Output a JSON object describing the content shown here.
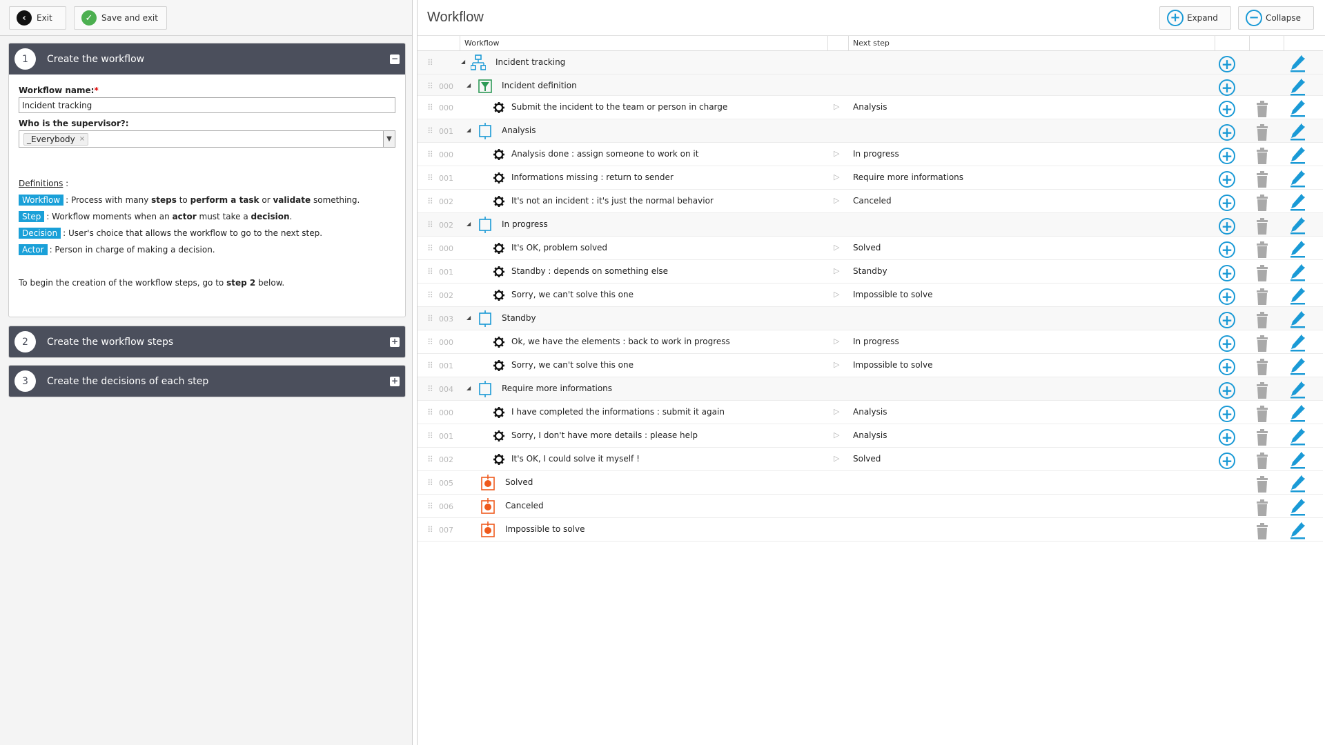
{
  "left": {
    "toolbar": {
      "exit_label": "Exit",
      "save_exit_label": "Save and exit"
    },
    "sections": [
      {
        "num": "1",
        "title": "Create the workflow",
        "toggle": "−"
      },
      {
        "num": "2",
        "title": "Create the workflow steps",
        "toggle": "+"
      },
      {
        "num": "3",
        "title": "Create the decisions of each step",
        "toggle": "+"
      }
    ],
    "form": {
      "name_label": "Workflow name:",
      "required_mark": "*",
      "name_value": "Incident tracking",
      "supervisor_label": "Who is the supervisor?:",
      "supervisor_tag": "_Everybody",
      "tag_remove": "×"
    },
    "definitions": {
      "title": "Definitions",
      "title_suffix": " :",
      "items": [
        {
          "badge": "Workflow",
          "parts": [
            ": Process with many ",
            "steps",
            " to ",
            "perform a task",
            " or ",
            "validate",
            " something."
          ]
        },
        {
          "badge": "Step",
          "parts": [
            ": Workflow moments when an ",
            "actor",
            " must take a ",
            "decision",
            "."
          ]
        },
        {
          "badge": "Decision",
          "parts": [
            ": User's choice that allows the workflow to go to the next step."
          ]
        },
        {
          "badge": "Actor",
          "parts": [
            ": Person in charge of making a decision."
          ]
        }
      ],
      "begin": {
        "pre": "To begin the creation of the workflow steps, go to ",
        "bold": "step 2",
        "post": " below."
      }
    }
  },
  "right": {
    "title": "Workflow",
    "expand_label": "Expand",
    "collapse_label": "Collapse",
    "columns": {
      "workflow": "Workflow",
      "next_step": "Next step"
    },
    "rows": [
      {
        "kind": "root",
        "idx": "",
        "label": "Incident tracking",
        "next": "",
        "add": true,
        "del": false
      },
      {
        "kind": "start",
        "idx": "000",
        "label": "Incident definition",
        "next": "",
        "add": true,
        "del": false
      },
      {
        "kind": "decision",
        "idx": "000",
        "label": "Submit the incident to the team or person in charge",
        "next": "Analysis",
        "add": true,
        "del": true
      },
      {
        "kind": "step",
        "idx": "001",
        "label": "Analysis",
        "next": "",
        "add": true,
        "del": true
      },
      {
        "kind": "decision",
        "idx": "000",
        "label": "Analysis done : assign someone to work on it",
        "next": "In progress",
        "add": true,
        "del": true
      },
      {
        "kind": "decision",
        "idx": "001",
        "label": "Informations missing : return to sender",
        "next": "Require more informations",
        "add": true,
        "del": true
      },
      {
        "kind": "decision",
        "idx": "002",
        "label": "It's not an incident : it's just the normal behavior",
        "next": "Canceled",
        "add": true,
        "del": true
      },
      {
        "kind": "step",
        "idx": "002",
        "label": "In progress",
        "next": "",
        "add": true,
        "del": true
      },
      {
        "kind": "decision",
        "idx": "000",
        "label": "It's OK, problem solved",
        "next": "Solved",
        "add": true,
        "del": true
      },
      {
        "kind": "decision",
        "idx": "001",
        "label": "Standby : depends on something else",
        "next": "Standby",
        "add": true,
        "del": true
      },
      {
        "kind": "decision",
        "idx": "002",
        "label": "Sorry, we can't solve this one",
        "next": "Impossible to solve",
        "add": true,
        "del": true
      },
      {
        "kind": "step",
        "idx": "003",
        "label": "Standby",
        "next": "",
        "add": true,
        "del": true
      },
      {
        "kind": "decision",
        "idx": "000",
        "label": "Ok, we have the elements : back to work in progress",
        "next": "In progress",
        "add": true,
        "del": true
      },
      {
        "kind": "decision",
        "idx": "001",
        "label": "Sorry, we can't solve this one",
        "next": "Impossible to solve",
        "add": true,
        "del": true
      },
      {
        "kind": "step",
        "idx": "004",
        "label": "Require more informations",
        "next": "",
        "add": true,
        "del": true
      },
      {
        "kind": "decision",
        "idx": "000",
        "label": "I have completed the informations : submit it again",
        "next": "Analysis",
        "add": true,
        "del": true
      },
      {
        "kind": "decision",
        "idx": "001",
        "label": "Sorry, I don't have more details : please help",
        "next": "Analysis",
        "add": true,
        "del": true
      },
      {
        "kind": "decision",
        "idx": "002",
        "label": "It's OK, I could solve it myself !",
        "next": "Solved",
        "add": true,
        "del": true
      },
      {
        "kind": "end",
        "idx": "005",
        "label": "Solved",
        "next": "",
        "add": false,
        "del": true
      },
      {
        "kind": "end",
        "idx": "006",
        "label": "Canceled",
        "next": "",
        "add": false,
        "del": true
      },
      {
        "kind": "end",
        "idx": "007",
        "label": "Impossible to solve",
        "next": "",
        "add": false,
        "del": true
      }
    ]
  },
  "icons": {
    "exit": "back-arrow-icon",
    "save": "checkmark-icon",
    "expand": "plus-circle-icon",
    "collapse": "minus-circle-icon",
    "grip": "drag-handle-icon",
    "root": "org-chart-icon",
    "start": "funnel-icon",
    "step": "step-box-icon",
    "decision": "gear-icon",
    "end": "end-stop-icon",
    "add": "plus-circle-icon",
    "delete": "trash-icon",
    "edit": "pencil-icon"
  },
  "colors": {
    "accent": "#1a9ad6",
    "badge": "#1aa0d8",
    "section_header": "#4b4f5c",
    "save_green": "#4caf50",
    "start_green": "#2e9a57",
    "end_orange": "#ef5a1d",
    "trash_gray": "#a9a9a9"
  }
}
